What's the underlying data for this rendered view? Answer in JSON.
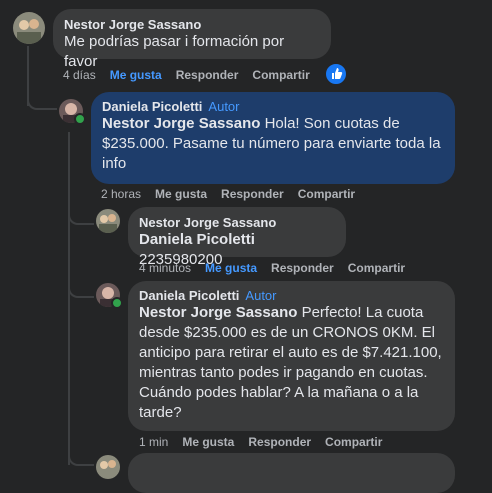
{
  "comments": [
    {
      "author": "Nestor Jorge Sassano",
      "text": "Me podrías pasar i formación por favor",
      "time": "4 días",
      "like": "Me gusta",
      "reply": "Responder",
      "share": "Compartir"
    },
    {
      "author": "Daniela Picoletti",
      "badge": "Autor",
      "mention": "Nestor Jorge Sassano",
      "text": " Hola! Son cuotas de $235.000. Pasame tu número para enviarte toda la info",
      "time": "2 horas",
      "like": "Me gusta",
      "reply": "Responder",
      "share": "Compartir"
    },
    {
      "author": "Nestor Jorge Sassano",
      "mention": "Daniela Picoletti",
      "text": " 2235980200",
      "time": "4 minutos",
      "like": "Me gusta",
      "reply": "Responder",
      "share": "Compartir"
    },
    {
      "author": "Daniela Picoletti",
      "badge": "Autor",
      "mention": "Nestor Jorge Sassano",
      "text": " Perfecto! La cuota desde $235.000 es de un CRONOS 0KM. El anticipo para retirar el auto es de $7.421.100, mientras tanto podes ir pagando en cuotas. Cuándo podes hablar? A la mañana o a la tarde?",
      "time": "1 min",
      "like": "Me gusta",
      "reply": "Responder",
      "share": "Compartir"
    }
  ],
  "colors": {
    "background": "#242526",
    "bubble": "#3a3b3c",
    "author_bubble": "#1e3d6b",
    "accent": "#4599ff",
    "online": "#31a24c"
  }
}
